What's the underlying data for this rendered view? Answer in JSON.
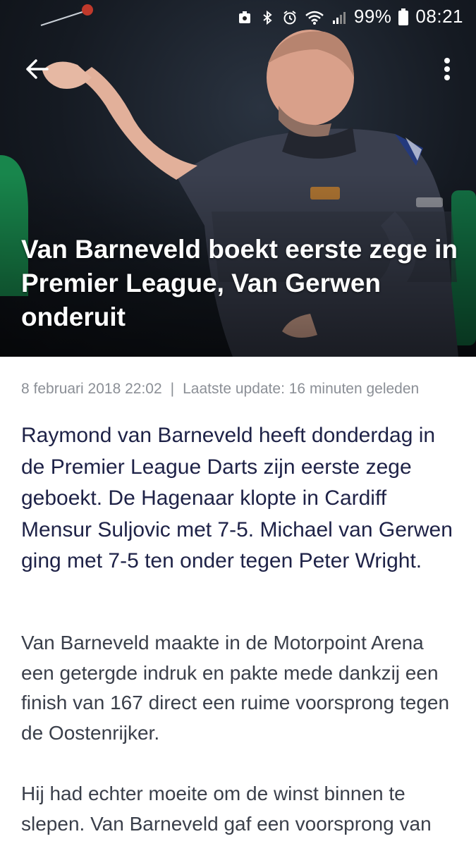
{
  "status_bar": {
    "battery_percent": "99%",
    "time": "08:21",
    "icons": [
      "screenshot-icon",
      "bluetooth-icon",
      "alarm-icon",
      "wifi-icon",
      "signal-icon",
      "battery-icon"
    ]
  },
  "toolbar": {
    "back_icon": "arrow-left-icon",
    "menu_icon": "more-vert-icon"
  },
  "article": {
    "headline": "Van Barneveld boekt eerste zege in Premier League, Van Gerwen onderuit",
    "date": "8 februari 2018 22:02",
    "separator": "|",
    "updated": "Laatste update: 16 minuten geleden",
    "lead": "Raymond van Barneveld heeft donderdag in de Premier League Darts zijn eerste zege geboekt. De Hagenaar klopte in Cardiff Mensur Suljovic met 7-5. Michael van Gerwen ging met 7-5 ten onder tegen Peter Wright.",
    "paragraphs": [
      "Van Barneveld maakte in de Motorpoint Arena een getergde indruk en pakte mede dankzij een finish van 167 direct een ruime voorsprong tegen de Oostenrijker.",
      "Hij had echter moeite om de winst binnen te slepen. Van Barneveld gaf een voorsprong van"
    ]
  },
  "colors": {
    "headline_text": "#ffffff",
    "lead_text": "#1e2247",
    "body_text": "#3a3f4a",
    "meta_text": "#8b8f96"
  }
}
